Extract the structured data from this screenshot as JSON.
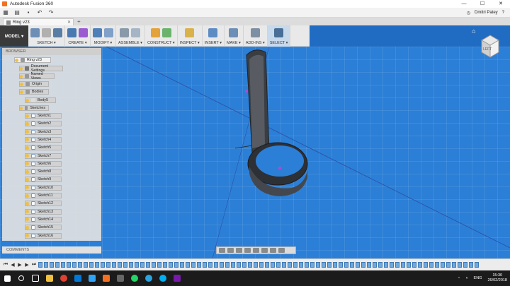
{
  "window": {
    "title": "Autodesk Fusion 360",
    "min": "—",
    "max": "☐",
    "close": "✕"
  },
  "qat": {
    "user": "Dmitri Patey",
    "help": "?"
  },
  "tab": {
    "title": "Ring v23"
  },
  "ribbon": {
    "mode": "MODEL ▾",
    "groups": [
      {
        "label": "SKETCH ▾"
      },
      {
        "label": "CREATE ▾"
      },
      {
        "label": "MODIFY ▾"
      },
      {
        "label": "ASSEMBLE ▾"
      },
      {
        "label": "CONSTRUCT ▾"
      },
      {
        "label": "INSPECT ▾"
      },
      {
        "label": "INSERT ▾"
      },
      {
        "label": "MAKE ▾"
      },
      {
        "label": "ADD-INS ▾"
      },
      {
        "label": "SELECT ▾"
      }
    ]
  },
  "browser": {
    "header": "BROWSER",
    "root": "Ring v23",
    "items": [
      "Document Settings",
      "Named Views",
      "Origin",
      "Bodies",
      "Body5",
      "Sketches"
    ],
    "sketches": [
      "Sketch1",
      "Sketch2",
      "Sketch3",
      "Sketch4",
      "Sketch5",
      "Sketch7",
      "Sketch6",
      "Sketch8",
      "Sketch9",
      "Sketch10",
      "Sketch11",
      "Sketch12",
      "Sketch13",
      "Sketch14",
      "Sketch15",
      "Sketch16"
    ]
  },
  "comments": {
    "label": "COMMENTS"
  },
  "viewcube": {
    "label": "LEFT"
  },
  "taskbar": {
    "lang": "ENG",
    "time": "15:30",
    "date": "26/02/2018"
  },
  "colors": {
    "canvas": "#2c7fd6",
    "fusion_orange": "#f37021"
  }
}
